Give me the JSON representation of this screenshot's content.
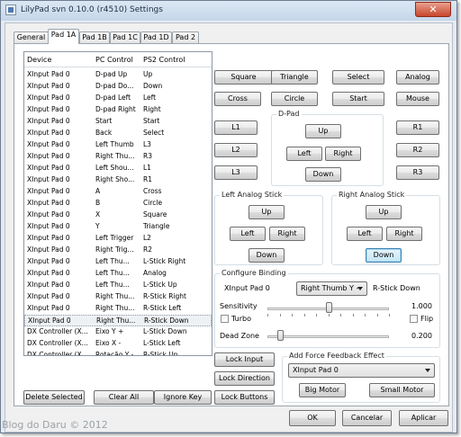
{
  "window": {
    "title": "LilyPad svn 0.10.0 (r4510) Settings",
    "close_label": "✕"
  },
  "tabs": [
    "General",
    "Pad 1A",
    "Pad 1B",
    "Pad 1C",
    "Pad 1D",
    "Pad 2"
  ],
  "active_tab": "Pad 1A",
  "bindings": {
    "headers": [
      "Device",
      "PC Control",
      "PS2 Control"
    ],
    "rows": [
      [
        "XInput Pad 0",
        "D-pad Up",
        "Up"
      ],
      [
        "XInput Pad 0",
        "D-pad Do...",
        "Down"
      ],
      [
        "XInput Pad 0",
        "D-pad Left",
        "Left"
      ],
      [
        "XInput Pad 0",
        "D-pad Right",
        "Right"
      ],
      [
        "XInput Pad 0",
        "Start",
        "Start"
      ],
      [
        "XInput Pad 0",
        "Back",
        "Select"
      ],
      [
        "XInput Pad 0",
        "Left Thumb",
        "L3"
      ],
      [
        "XInput Pad 0",
        "Right Thu...",
        "R3"
      ],
      [
        "XInput Pad 0",
        "Left Shou...",
        "L1"
      ],
      [
        "XInput Pad 0",
        "Right Sho...",
        "R1"
      ],
      [
        "XInput Pad 0",
        "A",
        "Cross"
      ],
      [
        "XInput Pad 0",
        "B",
        "Circle"
      ],
      [
        "XInput Pad 0",
        "X",
        "Square"
      ],
      [
        "XInput Pad 0",
        "Y",
        "Triangle"
      ],
      [
        "XInput Pad 0",
        "Left Trigger",
        "L2"
      ],
      [
        "XInput Pad 0",
        "Right Trig...",
        "R2"
      ],
      [
        "XInput Pad 0",
        "Left Thu...",
        "L-Stick Right"
      ],
      [
        "XInput Pad 0",
        "Left Thu...",
        "Analog"
      ],
      [
        "XInput Pad 0",
        "Left Thu...",
        "L-Stick Up"
      ],
      [
        "XInput Pad 0",
        "Right Thu...",
        "R-Stick Right"
      ],
      [
        "XInput Pad 0",
        "Right Thu...",
        "R-Stick Left"
      ],
      [
        "XInput Pad 0",
        "Right Thu...",
        "R-Stick Down"
      ],
      [
        "DX Controller (X...",
        "Eixo Y +",
        "L-Stick Down"
      ],
      [
        "DX Controller (X...",
        "Eixo X -",
        "L-Stick Left"
      ],
      [
        "DX Controller (X...",
        "Rotação Y -",
        "R-Stick Up"
      ]
    ],
    "selected_row": 21
  },
  "list_buttons": {
    "delete": "Delete Selected",
    "clear": "Clear All",
    "ignore": "Ignore Key"
  },
  "face_buttons": {
    "square": "Square",
    "triangle": "Triangle",
    "select": "Select",
    "analog": "Analog",
    "cross": "Cross",
    "circle": "Circle",
    "start": "Start",
    "mouse": "Mouse"
  },
  "shoulder_buttons": {
    "l1": "L1",
    "l2": "L2",
    "l3": "L3",
    "r1": "R1",
    "r2": "R2",
    "r3": "R3"
  },
  "dpad": {
    "title": "D-Pad",
    "up": "Up",
    "left": "Left",
    "right": "Right",
    "down": "Down"
  },
  "left_stick": {
    "title": "Left Analog Stick",
    "up": "Up",
    "left": "Left",
    "right": "Right",
    "down": "Down"
  },
  "right_stick": {
    "title": "Right Analog Stick",
    "up": "Up",
    "left": "Left",
    "right": "Right",
    "down": "Down"
  },
  "configure": {
    "title": "Configure Binding",
    "device": "XInput Pad 0",
    "control_selected": "Right Thumb Y -",
    "target": "R-Stick Down",
    "sensitivity_label": "Sensitivity",
    "sensitivity_value": "1.000",
    "sensitivity_level": 0.5,
    "turbo_label": "Turbo",
    "turbo_checked": false,
    "flip_label": "Flip",
    "flip_checked": false,
    "deadzone_label": "Dead Zone",
    "deadzone_value": "0.200",
    "deadzone_level": 0.1
  },
  "lock_buttons": {
    "input": "Lock Input",
    "direction": "Lock Direction",
    "buttons": "Lock Buttons"
  },
  "force_feedback": {
    "title": "Add Force Feedback Effect",
    "device": "XInput Pad 0",
    "big_motor": "Big Motor",
    "small_motor": "Small Motor"
  },
  "dialog_buttons": {
    "ok": "OK",
    "cancel": "Cancelar",
    "apply": "Aplicar"
  },
  "watermark": "Blog do Daru © 2012"
}
